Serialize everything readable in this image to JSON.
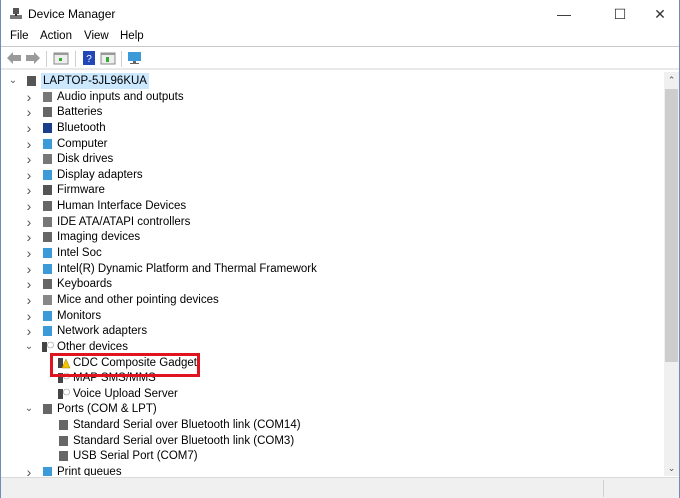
{
  "window": {
    "title": "Device Manager",
    "minimize_icon": "minimize-icon",
    "maximize_icon": "maximize-icon",
    "close_icon": "close-icon"
  },
  "menu": [
    "File",
    "Action",
    "View",
    "Help"
  ],
  "toolbar": [
    "back-icon",
    "forward-icon",
    "properties-icon",
    "help-icon",
    "update-driver-icon",
    "scan-hardware-icon"
  ],
  "tree": [
    {
      "label": "LAPTOP-5JL96KUA",
      "level": 0,
      "state": "expanded",
      "icon": "computer-icon",
      "selected": true
    },
    {
      "label": "Audio inputs and outputs",
      "level": 1,
      "state": "collapsed",
      "icon": "speaker-icon"
    },
    {
      "label": "Batteries",
      "level": 1,
      "state": "collapsed",
      "icon": "battery-icon"
    },
    {
      "label": "Bluetooth",
      "level": 1,
      "state": "collapsed",
      "icon": "bluetooth-icon"
    },
    {
      "label": "Computer",
      "level": 1,
      "state": "collapsed",
      "icon": "monitor-icon"
    },
    {
      "label": "Disk drives",
      "level": 1,
      "state": "collapsed",
      "icon": "disk-icon"
    },
    {
      "label": "Display adapters",
      "level": 1,
      "state": "collapsed",
      "icon": "display-adapter-icon"
    },
    {
      "label": "Firmware",
      "level": 1,
      "state": "collapsed",
      "icon": "firmware-icon"
    },
    {
      "label": "Human Interface Devices",
      "level": 1,
      "state": "collapsed",
      "icon": "hid-icon"
    },
    {
      "label": "IDE ATA/ATAPI controllers",
      "level": 1,
      "state": "collapsed",
      "icon": "ide-icon"
    },
    {
      "label": "Imaging devices",
      "level": 1,
      "state": "collapsed",
      "icon": "camera-icon"
    },
    {
      "label": "Intel Soc",
      "level": 1,
      "state": "collapsed",
      "icon": "monitor-icon"
    },
    {
      "label": "Intel(R) Dynamic Platform and Thermal Framework",
      "level": 1,
      "state": "collapsed",
      "icon": "monitor-icon"
    },
    {
      "label": "Keyboards",
      "level": 1,
      "state": "collapsed",
      "icon": "keyboard-icon"
    },
    {
      "label": "Mice and other pointing devices",
      "level": 1,
      "state": "collapsed",
      "icon": "mouse-icon"
    },
    {
      "label": "Monitors",
      "level": 1,
      "state": "collapsed",
      "icon": "monitor-icon"
    },
    {
      "label": "Network adapters",
      "level": 1,
      "state": "collapsed",
      "icon": "network-icon"
    },
    {
      "label": "Other devices",
      "level": 1,
      "state": "expanded",
      "icon": "unknown-device-icon"
    },
    {
      "label": "CDC Composite Gadget",
      "level": 2,
      "state": "leaf",
      "icon": "warning-device-icon",
      "highlighted": true
    },
    {
      "label": "MAP SMS/MMS",
      "level": 2,
      "state": "leaf",
      "icon": "unknown-device-icon"
    },
    {
      "label": "Voice Upload Server",
      "level": 2,
      "state": "leaf",
      "icon": "unknown-device-icon"
    },
    {
      "label": "Ports (COM & LPT)",
      "level": 1,
      "state": "expanded",
      "icon": "port-icon"
    },
    {
      "label": "Standard Serial over Bluetooth link (COM14)",
      "level": 2,
      "state": "leaf",
      "icon": "port-icon"
    },
    {
      "label": "Standard Serial over Bluetooth link (COM3)",
      "level": 2,
      "state": "leaf",
      "icon": "port-icon"
    },
    {
      "label": "USB Serial Port (COM7)",
      "level": 2,
      "state": "leaf",
      "icon": "port-icon"
    },
    {
      "label": "Print queues",
      "level": 1,
      "state": "collapsed",
      "icon": "printer-icon"
    }
  ],
  "colors": {
    "highlight": "#e0141e",
    "selection": "#cce8ff",
    "window_border": "#6d8fb7"
  }
}
